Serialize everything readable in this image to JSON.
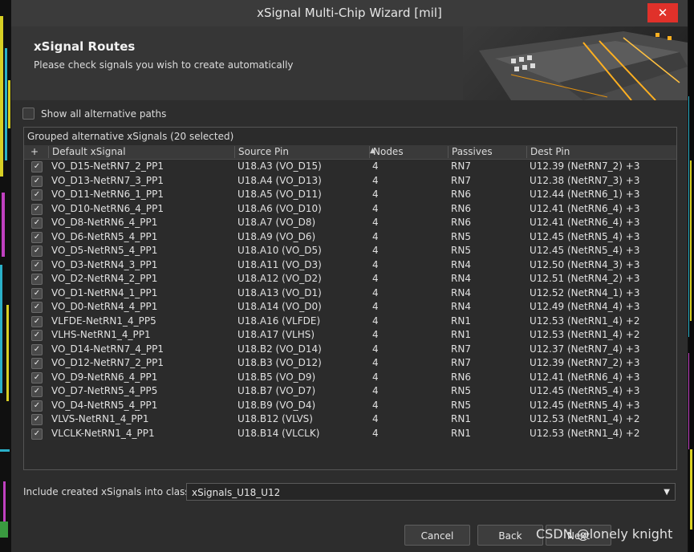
{
  "window": {
    "title": "xSignal Multi-Chip Wizard [mil]",
    "close_glyph": "✕"
  },
  "header": {
    "title": "xSignal Routes",
    "subtitle": "Please check signals you wish to create automatically"
  },
  "options": {
    "show_all_label": "Show all alternative paths",
    "show_all_checked": false
  },
  "group": {
    "label": "Grouped alternative xSignals (20 selected)",
    "columns": [
      "+",
      "Default xSignal",
      "Source Pin",
      "Nodes",
      "Passives",
      "Dest Pin"
    ],
    "sort_glyph": "▲",
    "check_glyph": "✓",
    "rows": [
      {
        "xsignal": "VO_D15-NetRN7_2_PP1",
        "source": "U18.A3 (VO_D15)",
        "nodes": "4",
        "passives": "RN7",
        "dest": "U12.39 (NetRN7_2) +3"
      },
      {
        "xsignal": "VO_D13-NetRN7_3_PP1",
        "source": "U18.A4 (VO_D13)",
        "nodes": "4",
        "passives": "RN7",
        "dest": "U12.38 (NetRN7_3) +3"
      },
      {
        "xsignal": "VO_D11-NetRN6_1_PP1",
        "source": "U18.A5 (VO_D11)",
        "nodes": "4",
        "passives": "RN6",
        "dest": "U12.44 (NetRN6_1) +3"
      },
      {
        "xsignal": "VO_D10-NetRN6_4_PP1",
        "source": "U18.A6 (VO_D10)",
        "nodes": "4",
        "passives": "RN6",
        "dest": "U12.41 (NetRN6_4) +3"
      },
      {
        "xsignal": "VO_D8-NetRN6_4_PP1",
        "source": "U18.A7 (VO_D8)",
        "nodes": "4",
        "passives": "RN6",
        "dest": "U12.41 (NetRN6_4) +3"
      },
      {
        "xsignal": "VO_D6-NetRN5_4_PP1",
        "source": "U18.A9 (VO_D6)",
        "nodes": "4",
        "passives": "RN5",
        "dest": "U12.45 (NetRN5_4) +3"
      },
      {
        "xsignal": "VO_D5-NetRN5_4_PP1",
        "source": "U18.A10 (VO_D5)",
        "nodes": "4",
        "passives": "RN5",
        "dest": "U12.45 (NetRN5_4) +3"
      },
      {
        "xsignal": "VO_D3-NetRN4_3_PP1",
        "source": "U18.A11 (VO_D3)",
        "nodes": "4",
        "passives": "RN4",
        "dest": "U12.50 (NetRN4_3) +3"
      },
      {
        "xsignal": "VO_D2-NetRN4_2_PP1",
        "source": "U18.A12 (VO_D2)",
        "nodes": "4",
        "passives": "RN4",
        "dest": "U12.51 (NetRN4_2) +3"
      },
      {
        "xsignal": "VO_D1-NetRN4_1_PP1",
        "source": "U18.A13 (VO_D1)",
        "nodes": "4",
        "passives": "RN4",
        "dest": "U12.52 (NetRN4_1) +3"
      },
      {
        "xsignal": "VO_D0-NetRN4_4_PP1",
        "source": "U18.A14 (VO_D0)",
        "nodes": "4",
        "passives": "RN4",
        "dest": "U12.49 (NetRN4_4) +3"
      },
      {
        "xsignal": "VLFDE-NetRN1_4_PP5",
        "source": "U18.A16 (VLFDE)",
        "nodes": "4",
        "passives": "RN1",
        "dest": "U12.53 (NetRN1_4) +2"
      },
      {
        "xsignal": "VLHS-NetRN1_4_PP1",
        "source": "U18.A17 (VLHS)",
        "nodes": "4",
        "passives": "RN1",
        "dest": "U12.53 (NetRN1_4) +2"
      },
      {
        "xsignal": "VO_D14-NetRN7_4_PP1",
        "source": "U18.B2 (VO_D14)",
        "nodes": "4",
        "passives": "RN7",
        "dest": "U12.37 (NetRN7_4) +3"
      },
      {
        "xsignal": "VO_D12-NetRN7_2_PP1",
        "source": "U18.B3 (VO_D12)",
        "nodes": "4",
        "passives": "RN7",
        "dest": "U12.39 (NetRN7_2) +3"
      },
      {
        "xsignal": "VO_D9-NetRN6_4_PP1",
        "source": "U18.B5 (VO_D9)",
        "nodes": "4",
        "passives": "RN6",
        "dest": "U12.41 (NetRN6_4) +3"
      },
      {
        "xsignal": "VO_D7-NetRN5_4_PP5",
        "source": "U18.B7 (VO_D7)",
        "nodes": "4",
        "passives": "RN5",
        "dest": "U12.45 (NetRN5_4) +3"
      },
      {
        "xsignal": "VO_D4-NetRN5_4_PP1",
        "source": "U18.B9 (VO_D4)",
        "nodes": "4",
        "passives": "RN5",
        "dest": "U12.45 (NetRN5_4) +3"
      },
      {
        "xsignal": "VLVS-NetRN1_4_PP1",
        "source": "U18.B12 (VLVS)",
        "nodes": "4",
        "passives": "RN1",
        "dest": "U12.53 (NetRN1_4) +2"
      },
      {
        "xsignal": "VLCLK-NetRN1_4_PP1",
        "source": "U18.B14 (VLCLK)",
        "nodes": "4",
        "passives": "RN1",
        "dest": "U12.53 (NetRN1_4) +2"
      }
    ]
  },
  "footer": {
    "include_label": "Include created xSignals into class:",
    "class_value": "xSignals_U18_U12",
    "dropdown_glyph": "▼",
    "cancel": "Cancel",
    "back": "Back",
    "next": "Next"
  },
  "watermark": "CSDN @lonely knight",
  "colors": {
    "window_bg": "#2d2d2d",
    "header_bg": "#363636",
    "close_red": "#e0312a",
    "text": "#e0e0e0",
    "pcb_trace_yellow": "#d8d024",
    "pcb_trace_cyan": "#2ab0c8",
    "pcb_trace_magenta": "#c040c0"
  }
}
